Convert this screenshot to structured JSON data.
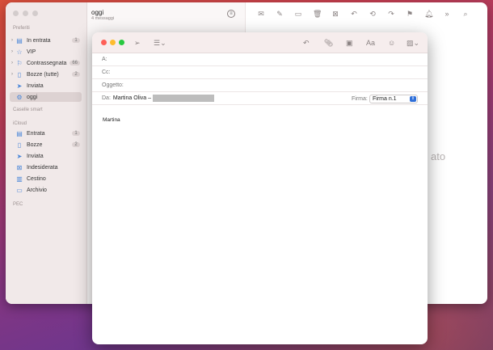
{
  "sidebar": {
    "sections": {
      "preferiti": "Preferiti",
      "caselle_smart": "Caselle smart",
      "icloud": "iCloud",
      "pec": "PEC"
    },
    "favorites": [
      {
        "label": "In entrata",
        "count": "1",
        "icon": "inbox-icon"
      },
      {
        "label": "VIP",
        "icon": "star-icon"
      },
      {
        "label": "Contrassegnata",
        "count": "66",
        "icon": "flag-icon"
      },
      {
        "label": "Bozze (tutte)",
        "count": "2",
        "icon": "draft-icon"
      },
      {
        "label": "Inviata",
        "icon": "sent-icon"
      },
      {
        "label": "oggi",
        "icon": "smart-mailbox-icon"
      }
    ],
    "icloud_items": [
      {
        "label": "Entrata",
        "count": "1",
        "icon": "inbox-icon"
      },
      {
        "label": "Bozze",
        "count": "2",
        "icon": "draft-icon"
      },
      {
        "label": "Inviata",
        "icon": "sent-icon"
      },
      {
        "label": "Indesiderata",
        "icon": "junk-icon"
      },
      {
        "label": "Cestino",
        "icon": "trash-icon"
      },
      {
        "label": "Archivio",
        "icon": "archive-icon"
      }
    ]
  },
  "listpane": {
    "title": "oggi",
    "subtitle": "4 messaggi"
  },
  "main": {
    "placeholder_partial": "ato"
  },
  "compose": {
    "to_label": "A:",
    "cc_label": "Cc:",
    "subject_label": "Oggetto:",
    "from_label": "Da:",
    "from_value": "Martina Oliva –",
    "firma_label": "Firma:",
    "firma_value": "Firma n.1",
    "font_button": "Aa",
    "body": "Martina"
  },
  "colors": {
    "close": "#fe5f57",
    "minimize": "#febc2e",
    "zoom": "#28c840",
    "accent": "#2f6fd8"
  }
}
